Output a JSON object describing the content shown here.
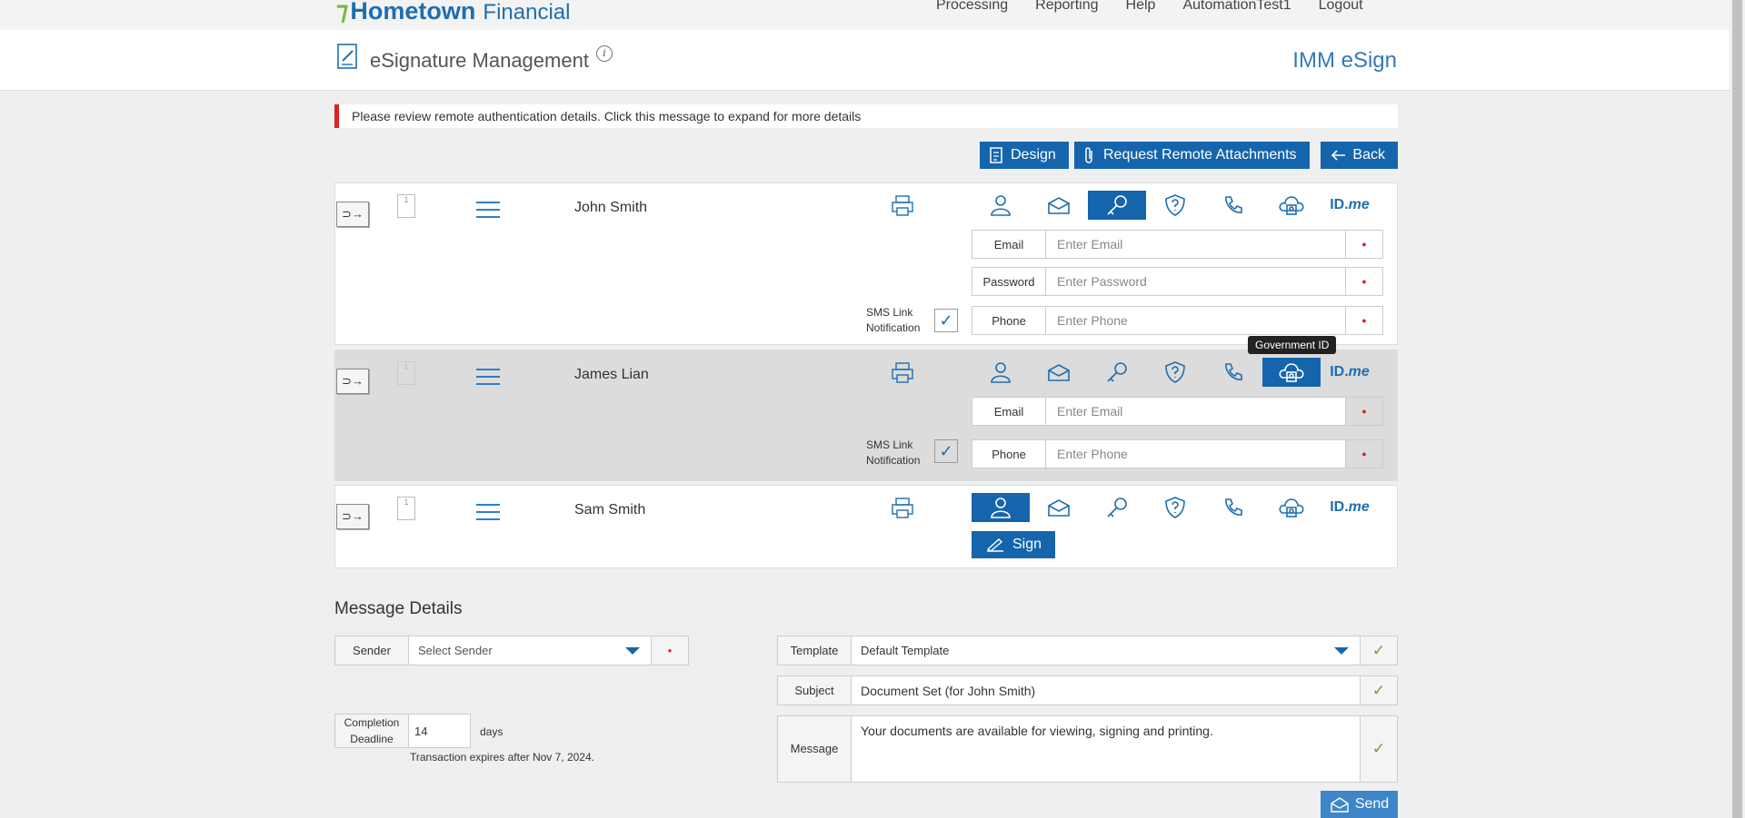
{
  "brand": {
    "logo_main": "Hometown",
    "logo_sub": "Financial"
  },
  "nav": [
    "Processing",
    "Reporting",
    "Help",
    "AutomationTest1",
    "Logout"
  ],
  "header": {
    "title": "eSignature Management",
    "info": "i",
    "product": "IMM eSign"
  },
  "alert": "Please review remote authentication details. Click this message to expand for more details",
  "actions": {
    "design": "Design",
    "request": "Request Remote Attachments",
    "back": "Back"
  },
  "signers": [
    {
      "name": "John Smith",
      "doc_num": "1",
      "fields": [
        {
          "label": "Email",
          "placeholder": "Enter Email"
        },
        {
          "label": "Password",
          "placeholder": "Enter Password"
        },
        {
          "label": "Phone",
          "placeholder": "Enter Phone"
        }
      ],
      "sms_label_1": "SMS Link",
      "sms_label_2": "Notification"
    },
    {
      "name": "James Lian",
      "doc_num": "1",
      "fields": [
        {
          "label": "Email",
          "placeholder": "Enter Email"
        },
        {
          "label": "Phone",
          "placeholder": "Enter Phone"
        }
      ],
      "sms_label_1": "SMS Link",
      "sms_label_2": "Notification",
      "tooltip": "Government ID"
    },
    {
      "name": "Sam Smith",
      "doc_num": "1",
      "sign_label": "Sign"
    }
  ],
  "idme": {
    "id": "ID.",
    "me": "me"
  },
  "message": {
    "heading": "Message Details",
    "sender_label": "Sender",
    "sender_value": "Select Sender",
    "deadline_label_1": "Completion",
    "deadline_label_2": "Deadline",
    "deadline_value": "14",
    "deadline_unit": "days",
    "expires": "Transaction expires after Nov 7, 2024.",
    "template_label": "Template",
    "template_value": "Default Template",
    "subject_label": "Subject",
    "subject_value": "Document Set (for John Smith)",
    "message_label": "Message",
    "message_value": "Your documents are available for viewing, signing and printing.",
    "send": "Send"
  }
}
